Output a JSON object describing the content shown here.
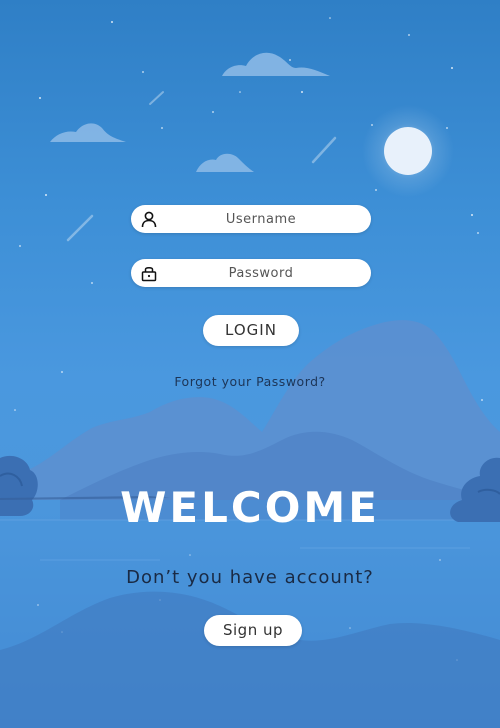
{
  "login_form": {
    "username_placeholder": "Username",
    "password_placeholder": "Password",
    "login_label": "LOGIN",
    "forgot_label": "Forgot your Password?"
  },
  "welcome": {
    "title": "WELCOME",
    "question": "Don’t you have account?",
    "signup_label": "Sign up"
  },
  "icons": {
    "username": "user-icon",
    "password": "lock-icon"
  },
  "colors": {
    "sky_top": "#2f7fc6",
    "sky_mid": "#4a98df",
    "field_bg": "#ffffff",
    "moon": "#e8f1fb"
  }
}
